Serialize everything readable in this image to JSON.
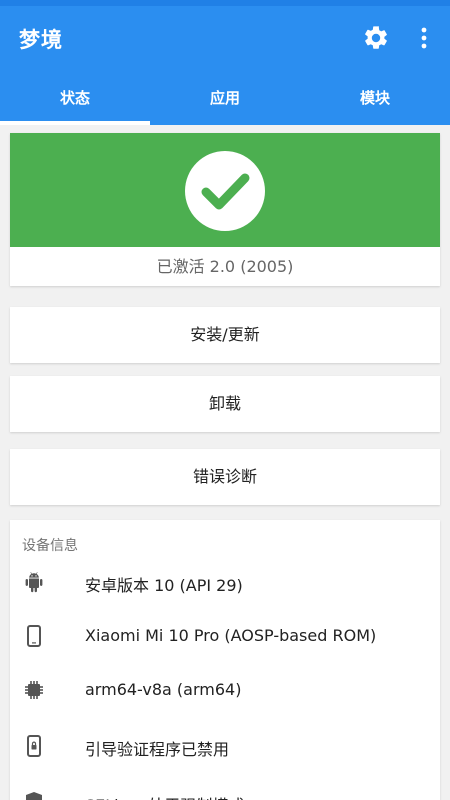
{
  "app": {
    "title": "梦境"
  },
  "tabs": [
    {
      "label": "状态",
      "selected": true
    },
    {
      "label": "应用",
      "selected": false
    },
    {
      "label": "模块",
      "selected": false
    }
  ],
  "status": {
    "text": "已激活 2.0 (2005)",
    "color": "#4caf50"
  },
  "actions": {
    "install_label": "安装/更新",
    "uninstall_label": "卸载",
    "diagnose_label": "错误诊断"
  },
  "device_info": {
    "title": "设备信息",
    "items": [
      {
        "icon": "android-icon",
        "text": "安卓版本 10 (API 29)"
      },
      {
        "icon": "phone-icon",
        "text": "Xiaomi Mi 10 Pro (AOSP-based ROM)"
      },
      {
        "icon": "chip-icon",
        "text": "arm64-v8a (arm64)"
      },
      {
        "icon": "phone-lock-icon",
        "text": "引导验证程序已禁用"
      },
      {
        "icon": "shield-icon",
        "text": "SELinux处于强制模式"
      }
    ]
  },
  "colors": {
    "primary": "#2b8ef0",
    "success": "#4caf50"
  }
}
